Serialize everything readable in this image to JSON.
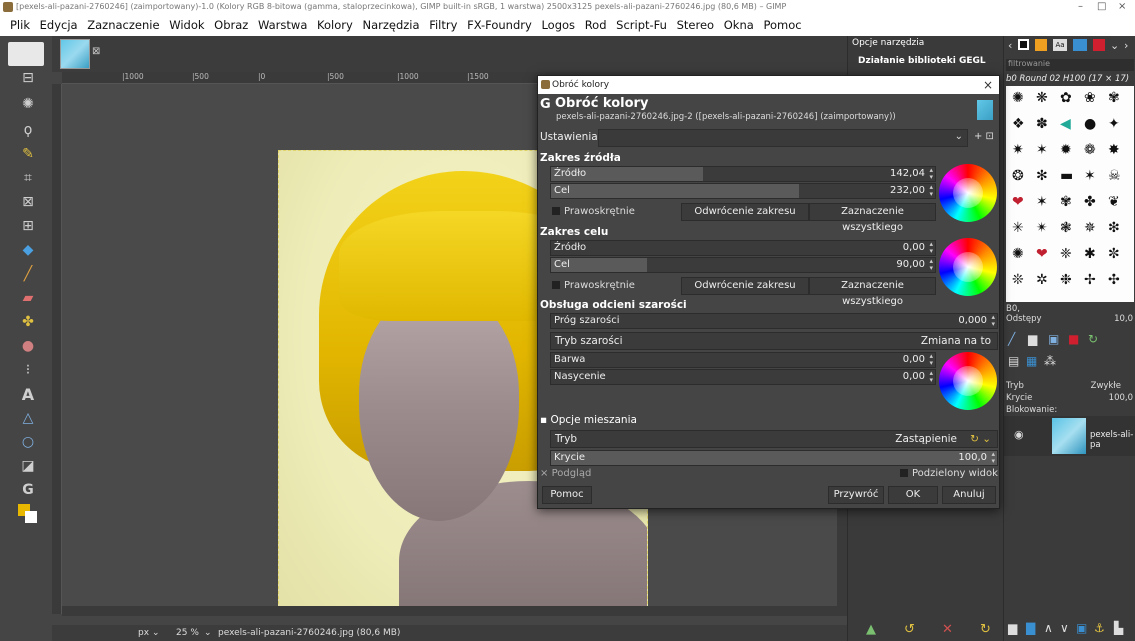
{
  "window": {
    "title": "[pexels-ali-pazani-2760246] (zaimportowany)-1.0 (Kolory RGB 8-bitowa (gamma, staloprzecinkowa), GIMP built-in sRGB, 1 warstwa) 2500x3125 pexels-ali-pazani-2760246.jpg (80,6 MB) – GIMP",
    "minimize": "–",
    "maximize": "□",
    "close": "×"
  },
  "menu": [
    "Plik",
    "Edycja",
    "Zaznaczenie",
    "Widok",
    "Obraz",
    "Warstwa",
    "Kolory",
    "Narzędzia",
    "Filtry",
    "FX-Foundry",
    "Logos",
    "Rod",
    "Script-Fu",
    "Stereo",
    "Okna",
    "Pomoc"
  ],
  "ruler": {
    "h_ticks": [
      "|1000",
      "|500",
      "|0",
      "|500",
      "|1000",
      "|1500"
    ],
    "v_ticks": [
      "0",
      "5",
      "1",
      "1",
      "1",
      "2",
      "2",
      "3"
    ]
  },
  "status": {
    "unit": "px",
    "zoom": "25 %",
    "file": "pexels-ali-pazani-2760246.jpg (80,6 MB)"
  },
  "tool_options": {
    "tab": "Opcje narzędzia",
    "heading": "Działanie biblioteki GEGL"
  },
  "brushes": {
    "filter": "filtrowanie",
    "name": "b0 Round 02 H100 (17 × 17)",
    "label_b": "B0,",
    "spacing_label": "Odstępy",
    "spacing_value": "10,0"
  },
  "layers": {
    "mode_label": "Tryb",
    "mode_value": "Zwykłe",
    "opacity_label": "Krycie",
    "opacity_value": "100,0",
    "lock_label": "Blokowanie:",
    "layer_name": "pexels-ali-pa"
  },
  "dialog": {
    "window_title": "Obróć kolory",
    "heading": "Obróć kolory",
    "subtitle": "pexels-ali-pazani-2760246.jpg-2 ([pexels-ali-pazani-2760246] (zaimportowany))",
    "presets_label": "Ustawienia:",
    "source_range": {
      "title": "Zakres źródła",
      "from_label": "Źródło",
      "from_value": "142,04",
      "from_fraction": 0.395,
      "to_label": "Cel",
      "to_value": "232,00",
      "to_fraction": 0.645,
      "clockwise": "Prawoskrętnie",
      "invert": "Odwrócenie zakresu",
      "select_all": "Zaznaczenie wszystkiego"
    },
    "dest_range": {
      "title": "Zakres celu",
      "from_label": "Źródło",
      "from_value": "0,00",
      "from_fraction": 0.0,
      "to_label": "Cel",
      "to_value": "90,00",
      "to_fraction": 0.25,
      "clockwise": "Prawoskrętnie",
      "invert": "Odwrócenie zakresu",
      "select_all": "Zaznaczenie wszystkiego"
    },
    "gray": {
      "title": "Obsługa odcieni szarości",
      "threshold_label": "Próg szarości",
      "threshold_value": "0,000",
      "mode_label": "Tryb szarości",
      "mode_value": "Zmiana na to",
      "hue_label": "Barwa",
      "hue_value": "0,00",
      "sat_label": "Nasycenie",
      "sat_value": "0,00"
    },
    "blending": {
      "title": "Opcje mieszania",
      "mode_label": "Tryb",
      "mode_value": "Zastąpienie",
      "opacity_label": "Krycie",
      "opacity_value": "100,0",
      "opacity_fraction": 1.0
    },
    "preview": "Podgląd",
    "split_view": "Podzielony widok",
    "help": "Pomoc",
    "reset": "Przywróć",
    "ok": "OK",
    "cancel": "Anuluj"
  }
}
